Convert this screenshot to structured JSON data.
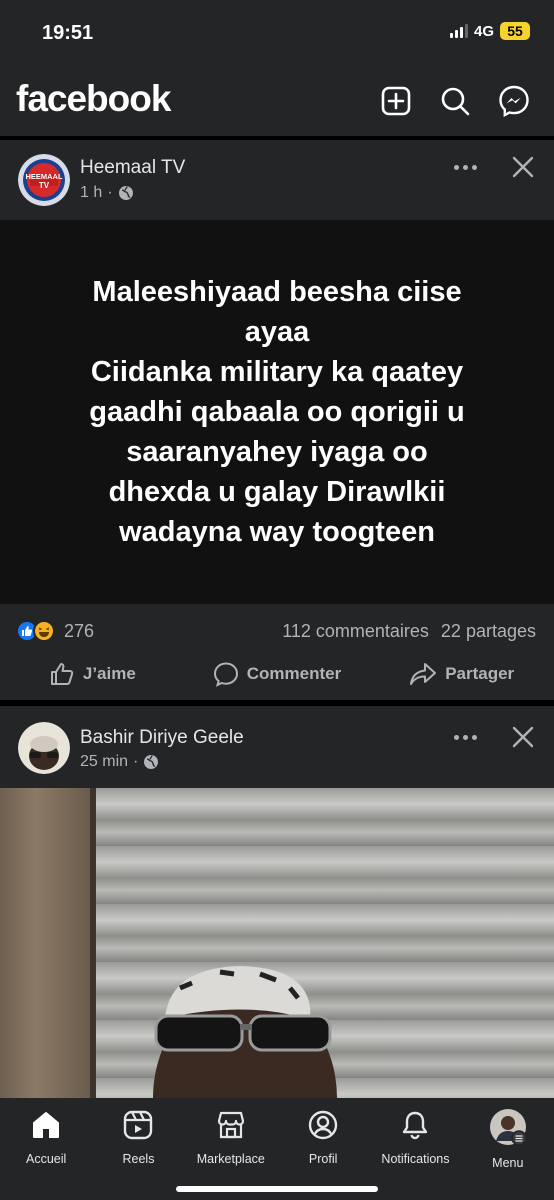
{
  "status_bar": {
    "time": "19:51",
    "network": "4G",
    "battery": "55"
  },
  "header": {
    "logo": "facebook",
    "icons": [
      "plus-square-icon",
      "search-icon",
      "messenger-icon"
    ]
  },
  "post1": {
    "author": "Heemaal TV",
    "avatar_label": "HEEMAAL",
    "avatar_label2": "TV",
    "time": "1 h",
    "text": "Maleeshiyaad beesha ciise\nayaa\nCiidanka military ka qaatey\ngaadhi qabaala oo qorigii u\nsaaranyahey iyaga oo\ndhexda u galay Dirawlkii\nwadayna way toogteen",
    "reaction_count": "276",
    "comments": "112 commentaires",
    "shares": "22 partages",
    "actions": {
      "like": "J’aime",
      "comment": "Commenter",
      "share": "Partager"
    }
  },
  "post2": {
    "author": "Bashir Diriye Geele",
    "time": "25 min"
  },
  "bottom_nav": [
    {
      "label": "Accueil",
      "icon": "home-icon"
    },
    {
      "label": "Reels",
      "icon": "reels-icon"
    },
    {
      "label": "Marketplace",
      "icon": "marketplace-icon"
    },
    {
      "label": "Profil",
      "icon": "profile-icon"
    },
    {
      "label": "Notifications",
      "icon": "bell-icon"
    },
    {
      "label": "Menu",
      "icon": "menu-avatar-icon"
    }
  ],
  "colors": {
    "background": "#000000",
    "surface": "#242526",
    "text": "#e4e6eb",
    "secondary_text": "#b0b3b8",
    "accent": "#1877f2"
  }
}
